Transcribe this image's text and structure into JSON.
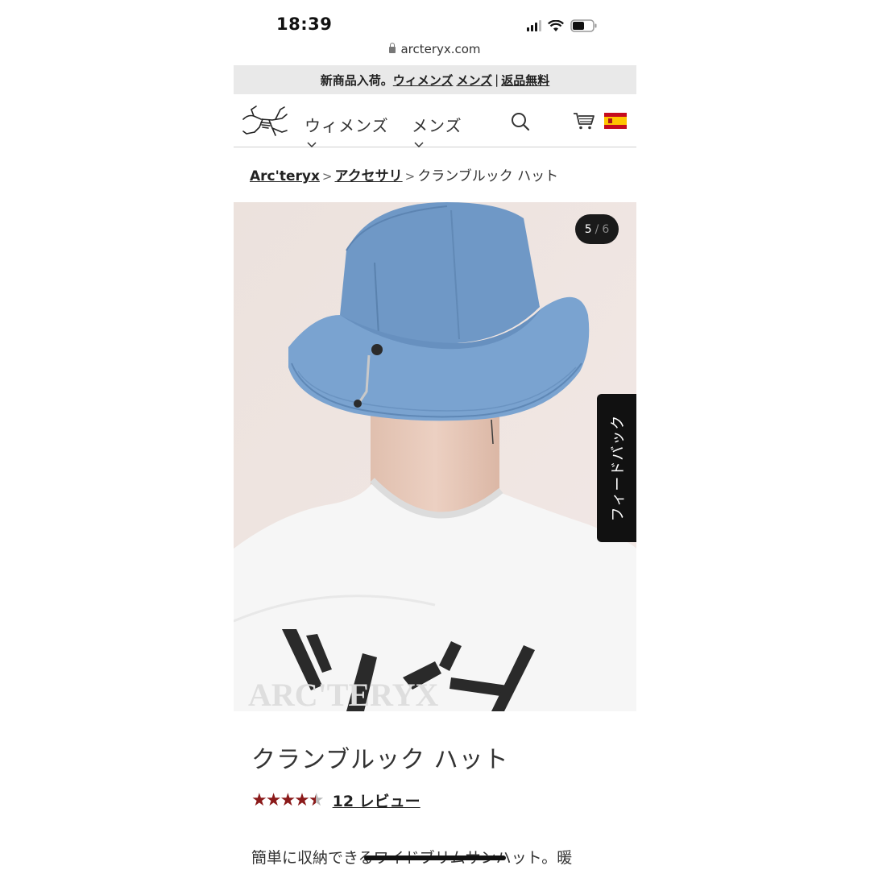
{
  "status": {
    "time": "18:39"
  },
  "browser": {
    "url": "arcteryx.com"
  },
  "promo": {
    "prefix": "新商品入荷。",
    "womens_link": "ウィメンズ",
    "mens_link": "メンズ",
    "separator": "|",
    "free_returns_link": "返品無料"
  },
  "nav": {
    "items": [
      {
        "label": "ウィメンズ"
      },
      {
        "label": "メンズ"
      }
    ],
    "search_icon": "search-icon",
    "cart_icon": "cart-icon",
    "locale_flag": "spain-flag"
  },
  "breadcrumb": [
    {
      "label": "Arc'teryx"
    },
    {
      "label": "アクセサリ"
    },
    {
      "label": "クランブルック ハット"
    }
  ],
  "gallery": {
    "current": "5",
    "separator": "/",
    "total": "6"
  },
  "feedback": {
    "label": "フィードバック"
  },
  "product": {
    "title": "クランブルック ハット",
    "rating": 4.5,
    "reviews_label": "12 レビュー",
    "description": "簡単に収納できるワイドブリムサンハット。暖"
  },
  "colors": {
    "star": "#8b1a1a",
    "hat": "#6f98c6",
    "banner": "#e9e9e9"
  }
}
